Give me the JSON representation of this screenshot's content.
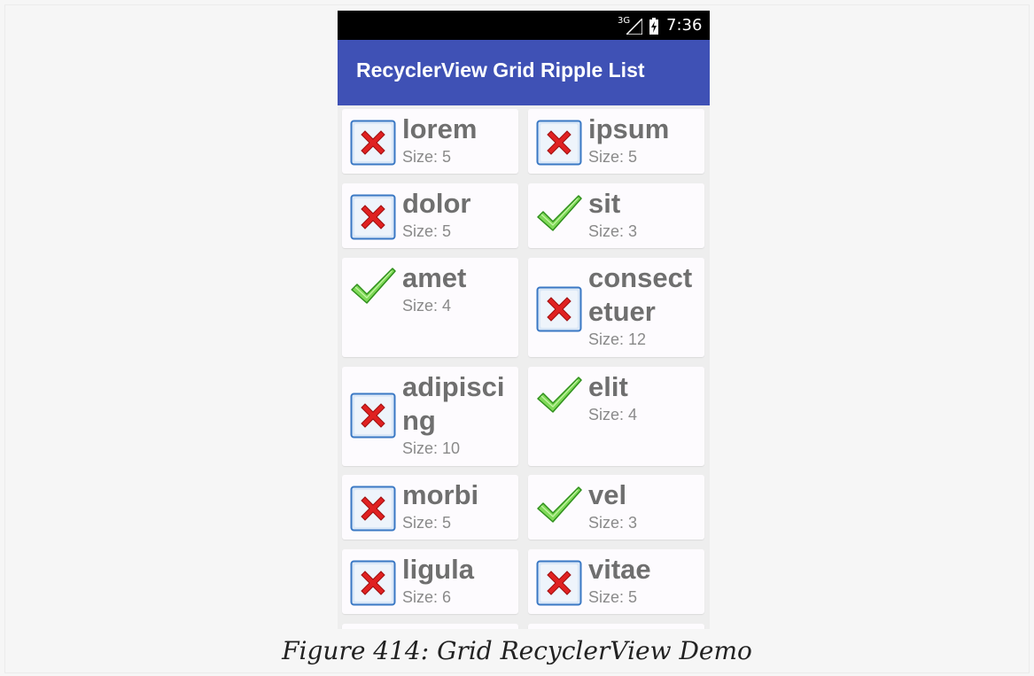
{
  "status_bar": {
    "network": "3G",
    "time": "7:36"
  },
  "action_bar": {
    "title": "RecyclerView Grid Ripple List"
  },
  "items": [
    {
      "name": "lorem",
      "size": "Size: 5",
      "icon": "red-x-icon"
    },
    {
      "name": "ipsum",
      "size": "Size: 5",
      "icon": "red-x-icon"
    },
    {
      "name": "dolor",
      "size": "Size: 5",
      "icon": "red-x-icon"
    },
    {
      "name": "sit",
      "size": "Size: 3",
      "icon": "green-check-icon"
    },
    {
      "name": "amet",
      "size": "Size: 4",
      "icon": "green-check-icon"
    },
    {
      "name": "consectetuer",
      "size": "Size: 12",
      "icon": "red-x-icon"
    },
    {
      "name": "adipiscing",
      "size": "Size: 10",
      "icon": "red-x-icon"
    },
    {
      "name": "elit",
      "size": "Size: 4",
      "icon": "green-check-icon"
    },
    {
      "name": "morbi",
      "size": "Size: 5",
      "icon": "red-x-icon"
    },
    {
      "name": "vel",
      "size": "Size: 3",
      "icon": "green-check-icon"
    },
    {
      "name": "ligula",
      "size": "Size: 6",
      "icon": "red-x-icon"
    },
    {
      "name": "vitae",
      "size": "Size: 5",
      "icon": "red-x-icon"
    }
  ],
  "caption": "Figure 414: Grid RecyclerView Demo",
  "colors": {
    "action_bar": "#3f51b5",
    "status_bar": "#000000",
    "card": "#fdfbfe"
  }
}
